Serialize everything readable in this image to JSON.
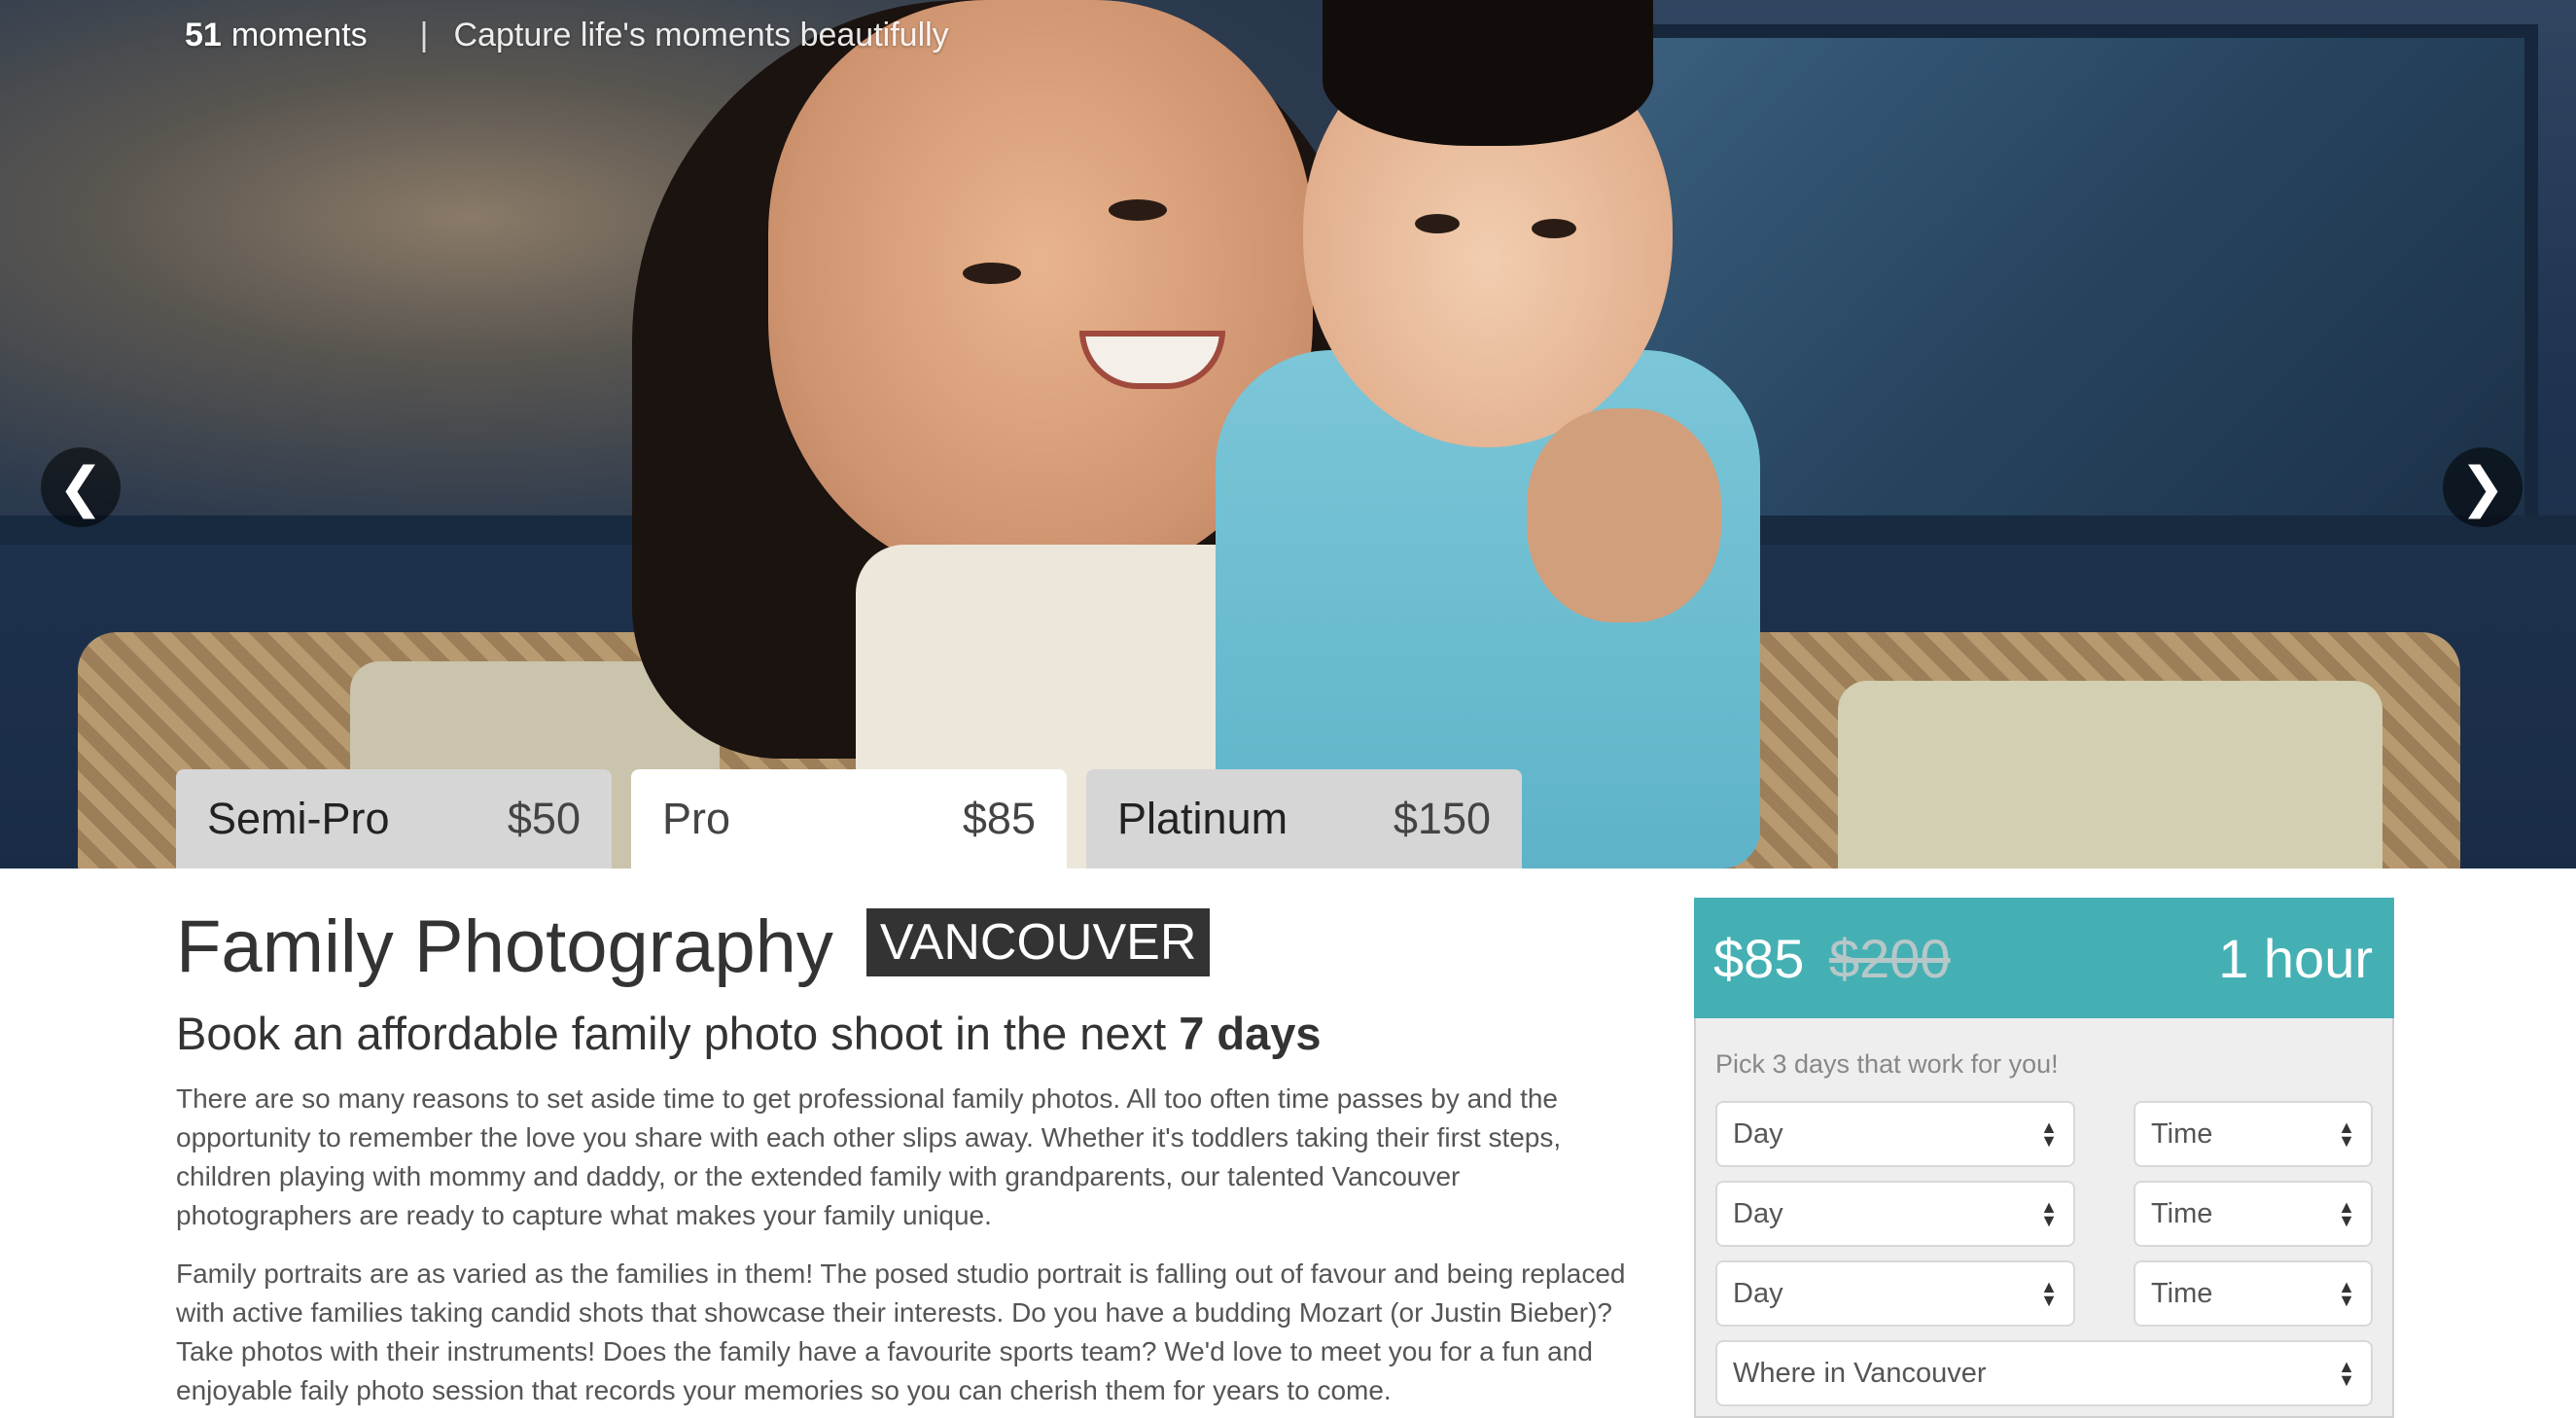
{
  "header": {
    "moments_count": "51",
    "moments_label": "moments",
    "separator": "|",
    "tagline": "Capture life's moments beautifully"
  },
  "carousel": {
    "prev_glyph": "❮",
    "next_glyph": "❯"
  },
  "tiers": [
    {
      "name": "Semi-Pro",
      "price": "$50",
      "selected": false
    },
    {
      "name": "Pro",
      "price": "$85",
      "selected": true
    },
    {
      "name": "Platinum",
      "price": "$150",
      "selected": false
    }
  ],
  "main": {
    "title": "Family Photography",
    "city": "VANCOUVER",
    "subtitle_prefix": "Book an affordable family photo shoot in the next",
    "subtitle_emphasis": "7 days",
    "paragraphs": [
      "There are so many reasons to set aside time to get professional family photos. All too often time passes by and the opportunity to remember the love you share with each other slips away. Whether it's toddlers taking their first steps, children playing with mommy and daddy, or the extended family with grandparents, our talented Vancouver photographers are ready to capture what makes your family unique.",
      "Family portraits are as varied as the families in them! The posed studio portrait is falling out of favour and being replaced with active families taking candid shots that showcase their interests. Do you have a budding Mozart (or Justin Bieber)? Take photos with their instruments! Does the family have a favourite sports team? We'd love to meet you for a fun and enjoyable faily photo session that records your memories so you can cherish them for years to come."
    ]
  },
  "booking": {
    "price": "$85",
    "old_price": "$200",
    "duration": "1 hour",
    "pick_label": "Pick 3 days that work for you!",
    "day_placeholder": "Day",
    "time_placeholder": "Time",
    "location_placeholder": "Where in Vancouver",
    "accent_color": "#45b0b4"
  }
}
